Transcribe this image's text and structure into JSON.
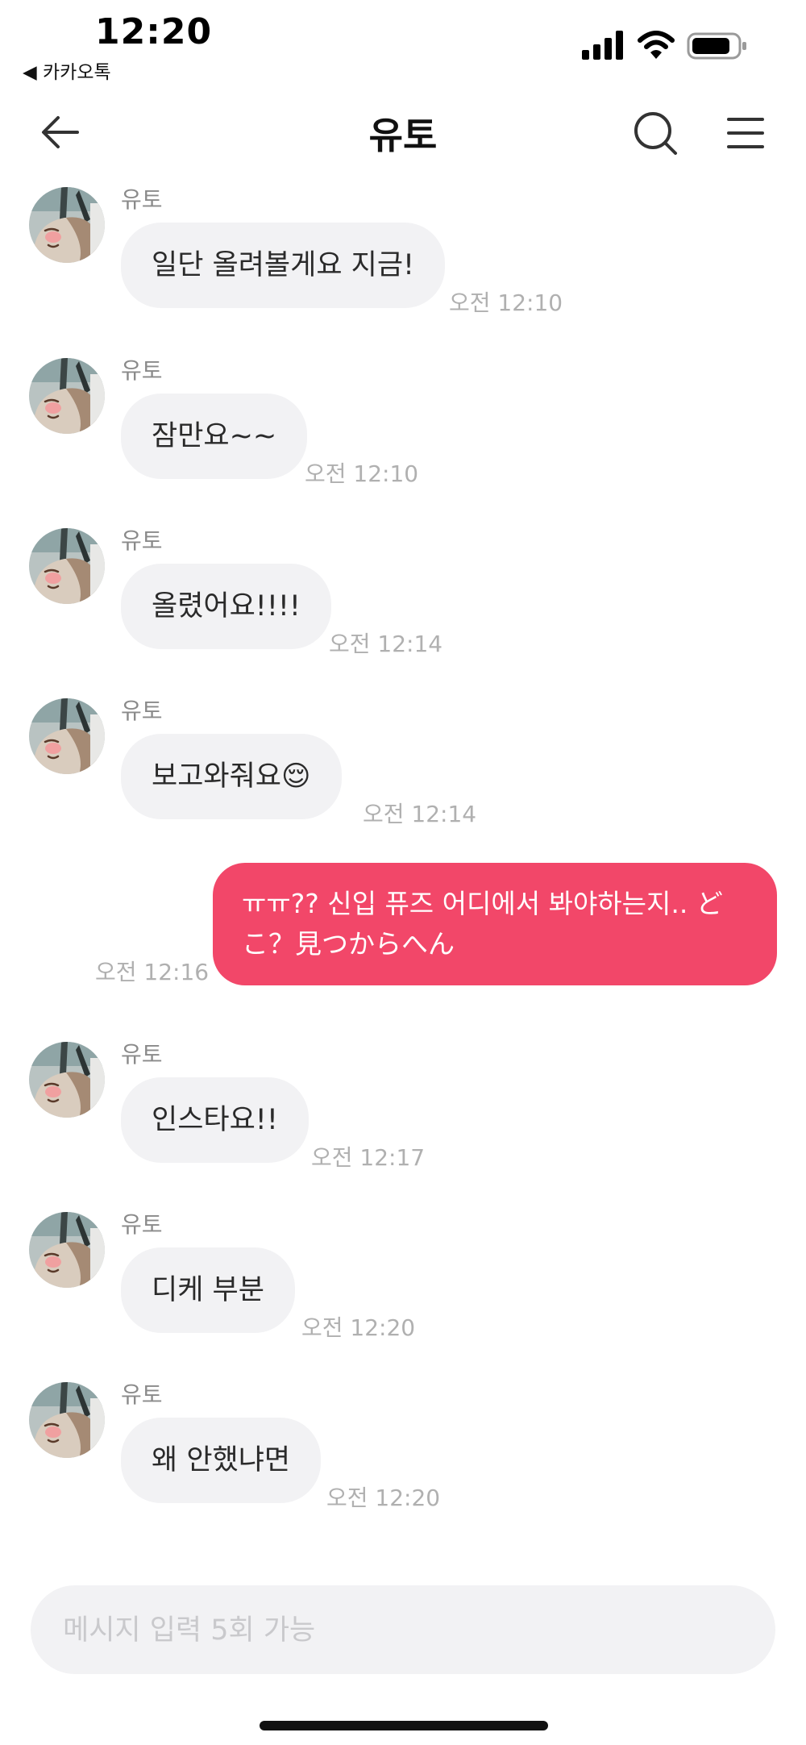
{
  "status": {
    "time": "12:20",
    "back_app": "◀ 카카오톡"
  },
  "header": {
    "title": "유토"
  },
  "messages": [
    {
      "side": "in",
      "sender": "유토",
      "text": "일단 올려볼게요 지금!",
      "time": "오전 12:10"
    },
    {
      "side": "in",
      "sender": "유토",
      "text": "잠만요~~",
      "time": "오전 12:10"
    },
    {
      "side": "in",
      "sender": "유토",
      "text": "올렸어요!!!!",
      "time": "오전 12:14"
    },
    {
      "side": "in",
      "sender": "유토",
      "text": "보고와줘요😌",
      "time": "오전 12:14"
    },
    {
      "side": "out",
      "text": "ㅠㅠ?? 신입 퓨즈 어디에서 봐야하는지.. どこ？見つからへん",
      "time": "오전 12:16"
    },
    {
      "side": "in",
      "sender": "유토",
      "text": "인스타요!!",
      "time": "오전 12:17"
    },
    {
      "side": "in",
      "sender": "유토",
      "text": "디케 부분",
      "time": "오전 12:20"
    },
    {
      "side": "in",
      "sender": "유토",
      "text": "왜 안했냐면",
      "time": "오전 12:20"
    }
  ],
  "composer": {
    "placeholder": "메시지 입력 5회 가능"
  },
  "colors": {
    "outgoing_bubble": "#f24769",
    "incoming_bubble": "#f2f2f4",
    "timestamp": "#b0b0b0"
  }
}
